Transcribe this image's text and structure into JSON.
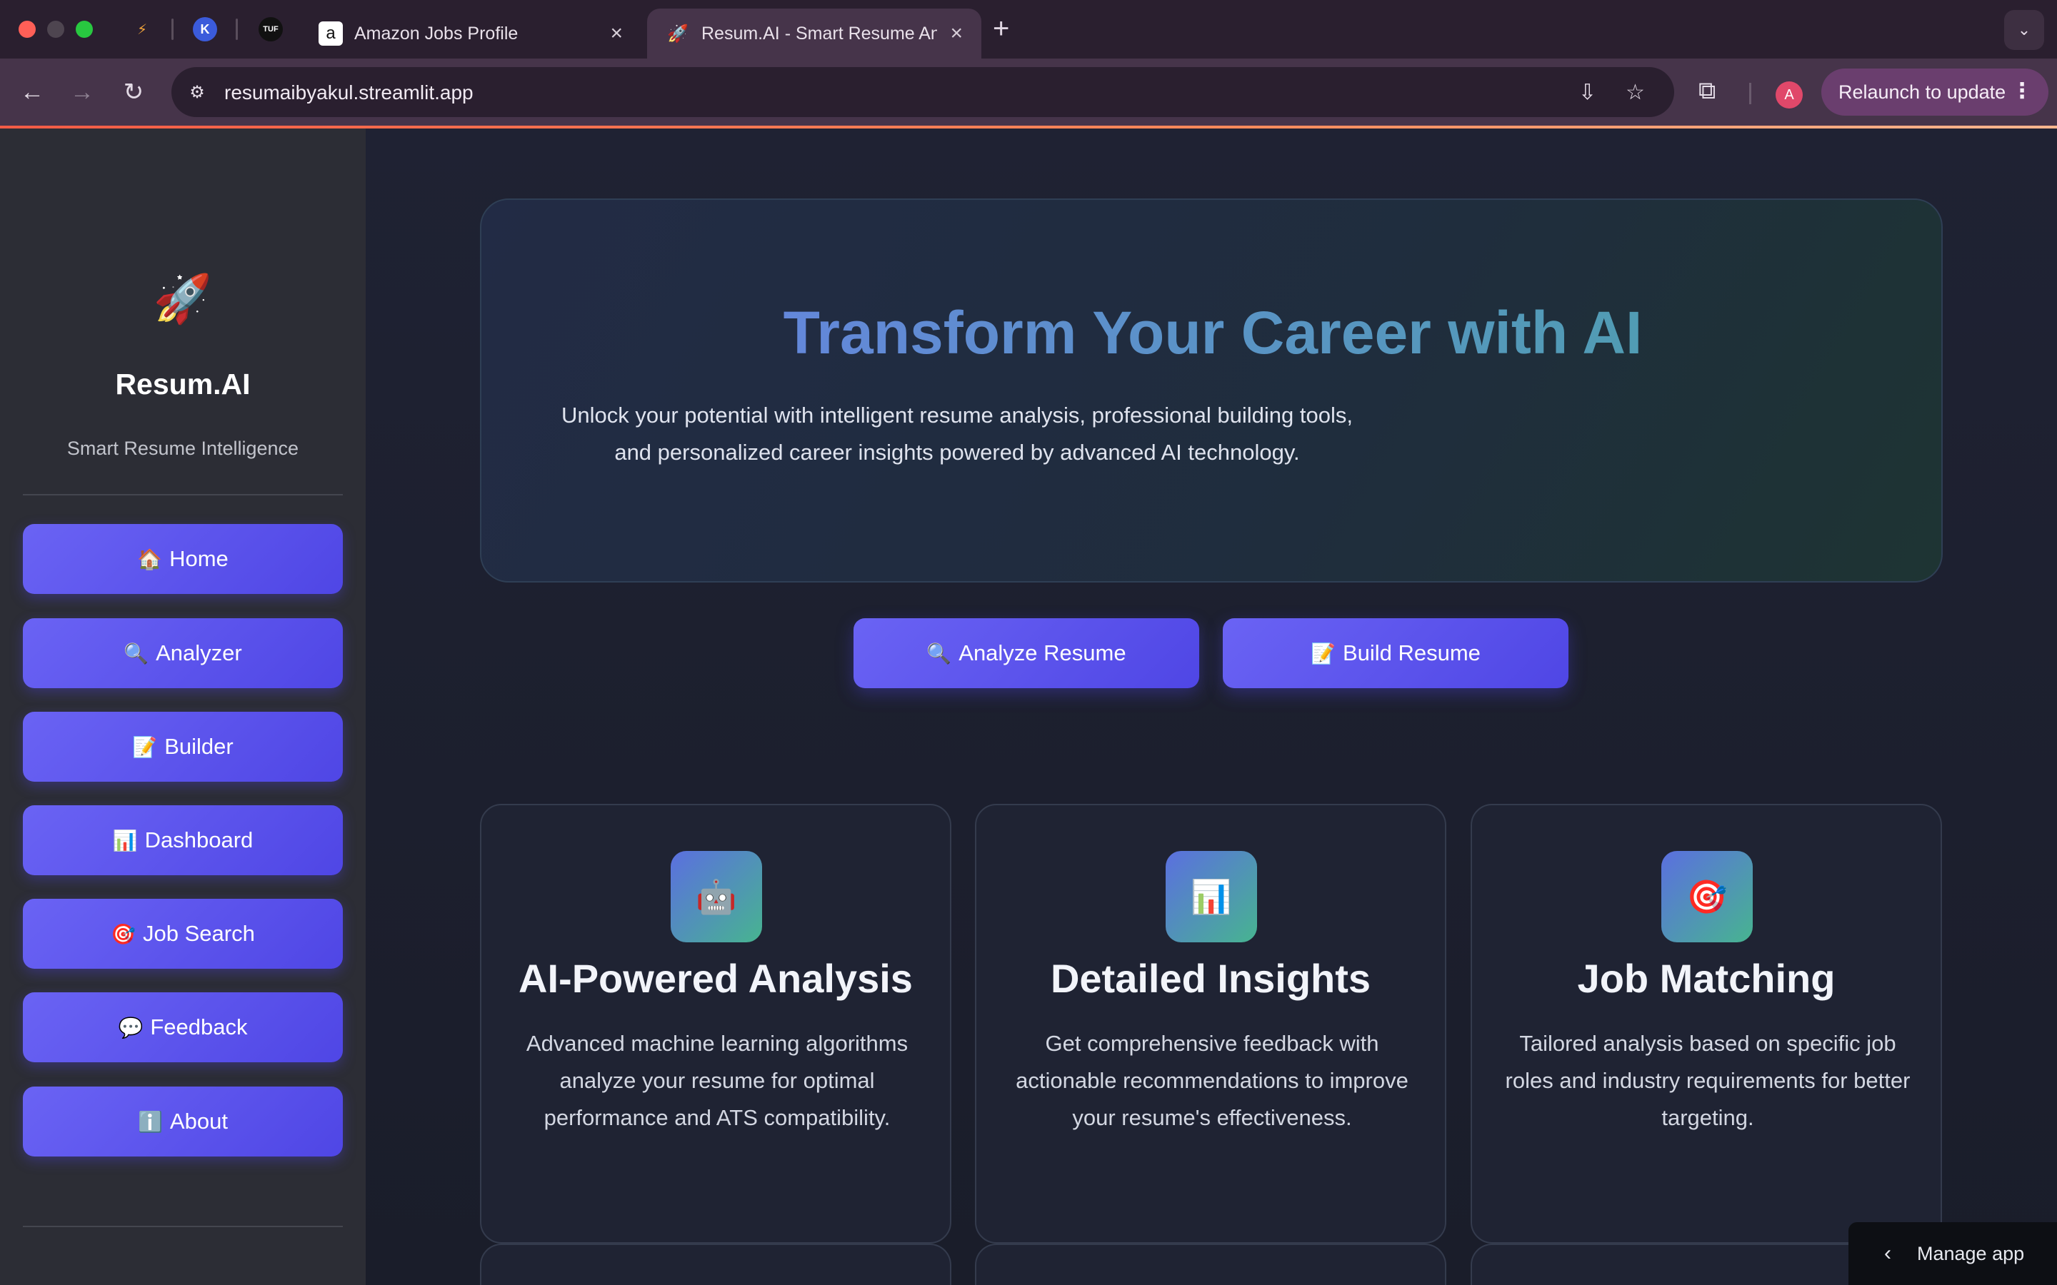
{
  "browser": {
    "tabs": [
      {
        "title": "Amazon Jobs Profile",
        "favicon": "a"
      },
      {
        "title": "Resum.AI - Smart Resume Analyzer",
        "favicon": "🚀"
      }
    ],
    "pinned_labels": [
      "TUF"
    ],
    "url": "resumaibyakul.streamlit.app",
    "profile_initial": "A",
    "relaunch_label": "Relaunch to update"
  },
  "sidebar": {
    "logo": "🚀",
    "brand": "Resum.AI",
    "tagline": "Smart Resume Intelligence",
    "items": [
      {
        "icon": "🏠",
        "label": "Home"
      },
      {
        "icon": "🔍",
        "label": "Analyzer"
      },
      {
        "icon": "📝",
        "label": "Builder"
      },
      {
        "icon": "📊",
        "label": "Dashboard"
      },
      {
        "icon": "🎯",
        "label": "Job Search"
      },
      {
        "icon": "💬",
        "label": "Feedback"
      },
      {
        "icon": "ℹ️",
        "label": "About"
      }
    ]
  },
  "hero": {
    "title": "Transform Your Career with AI",
    "subtitle": "Unlock your potential with intelligent resume analysis, professional building tools, and personalized career insights powered by advanced AI technology."
  },
  "actions": {
    "analyze": {
      "icon": "🔍",
      "label": "Analyze Resume"
    },
    "build": {
      "icon": "📝",
      "label": "Build Resume"
    }
  },
  "features": [
    {
      "icon": "🤖",
      "title": "AI-Powered Analysis",
      "description": "Advanced machine learning algorithms analyze your resume for optimal performance and ATS compatibility."
    },
    {
      "icon": "📊",
      "title": "Detailed Insights",
      "description": "Get comprehensive feedback with actionable recommendations to improve your resume's effectiveness."
    },
    {
      "icon": "🎯",
      "title": "Job Matching",
      "description": "Tailored analysis based on specific job roles and industry requirements for better targeting."
    }
  ],
  "manage_app": "Manage app",
  "colors": {
    "accent_button": "#4f46e5",
    "hero_gradient_start": "#6a7fe8",
    "hero_gradient_end": "#4aa2a6",
    "card_border": "#343b4d"
  }
}
